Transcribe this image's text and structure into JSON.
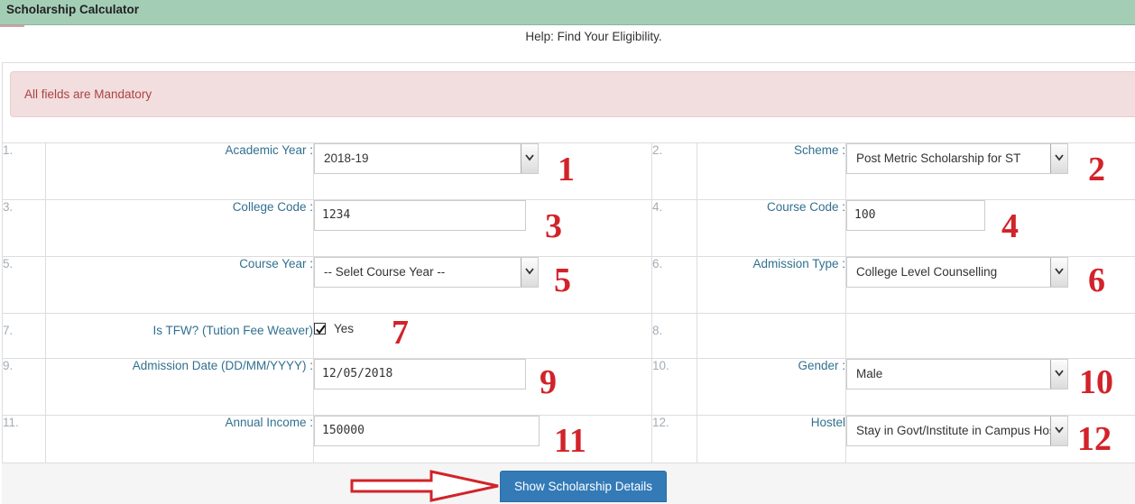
{
  "header": {
    "title": "Scholarship Calculator"
  },
  "help_text": "Help: Find Your Eligibility.",
  "alert": {
    "text": "All fields are Mandatory"
  },
  "rows": [
    {
      "left": {
        "num": "1.",
        "label": "Academic Year :",
        "type": "select",
        "value": "2018-19",
        "annotation": "1"
      },
      "right": {
        "num": "2.",
        "label": "Scheme :",
        "type": "select",
        "value": "Post Metric Scholarship for ST",
        "annotation": "2"
      }
    },
    {
      "left": {
        "num": "3.",
        "label": "College Code :",
        "type": "input",
        "value": "1234",
        "annotation": "3"
      },
      "right": {
        "num": "4.",
        "label": "Course Code :",
        "type": "input",
        "value": "100",
        "annotation": "4"
      }
    },
    {
      "left": {
        "num": "5.",
        "label": "Course Year :",
        "type": "select",
        "value": "-- Selet Course Year --",
        "annotation": "5"
      },
      "right": {
        "num": "6.",
        "label": "Admission Type :",
        "type": "select",
        "value": "College Level Counselling",
        "annotation": "6"
      }
    },
    {
      "left": {
        "num": "7.",
        "label": "Is TFW? (Tution Fee Weaver)",
        "type": "checkbox",
        "checked": true,
        "value": "Yes",
        "annotation": "7"
      },
      "right": {
        "num": "8.",
        "label": "",
        "type": "empty"
      }
    },
    {
      "left": {
        "num": "9.",
        "label": "Admission Date (DD/MM/YYYY) :",
        "type": "input",
        "value": "12/05/2018",
        "annotation": "9"
      },
      "right": {
        "num": "10.",
        "label": "Gender :",
        "type": "select",
        "value": "Male",
        "annotation": "10"
      }
    },
    {
      "left": {
        "num": "11.",
        "label": "Annual Income :",
        "type": "input",
        "value": "150000",
        "annotation": "11"
      },
      "right": {
        "num": "12.",
        "label": "Hostel",
        "type": "select",
        "value": "Stay in Govt/Institute in Campus Hostel",
        "annotation": "12"
      }
    }
  ],
  "submit": {
    "label": "Show Scholarship Details"
  },
  "colors": {
    "header_bg": "#a4cdb6",
    "alert_bg": "#f2dede",
    "alert_text": "#a94442",
    "label": "#31708f",
    "button": "#337ab7",
    "annotation": "#d2232a"
  }
}
